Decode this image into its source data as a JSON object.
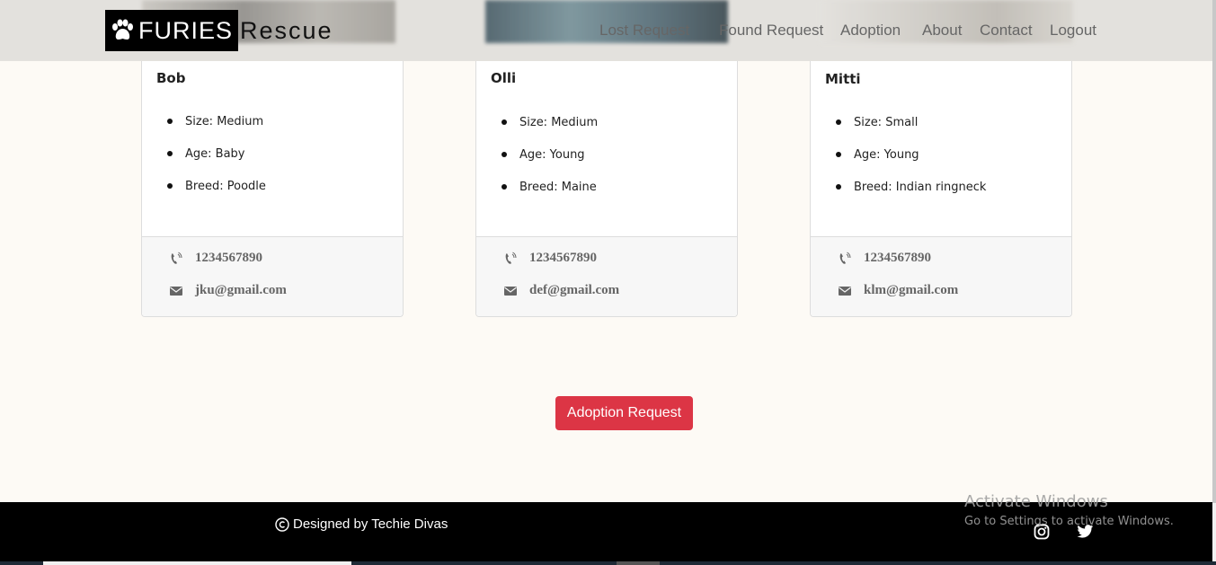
{
  "brand": {
    "highlight": "FURIES",
    "rest": "Rescue"
  },
  "nav": {
    "links": [
      "Lost Request",
      "Found Request",
      "Adoption",
      "About",
      "Contact",
      "Logout"
    ]
  },
  "pets": [
    {
      "name": "Bob",
      "details": [
        "Size: Medium",
        "Age: Baby",
        "Breed: Poodle"
      ],
      "phone": "1234567890",
      "email": "jku@gmail.com"
    },
    {
      "name": "Olli",
      "details": [
        "Size: Medium",
        "Age: Young",
        "Breed: Maine"
      ],
      "phone": "1234567890",
      "email": "def@gmail.com"
    },
    {
      "name": "Mitti",
      "details": [
        "Size: Small",
        "Age: Young",
        "Breed: Indian ringneck"
      ],
      "phone": "1234567890",
      "email": "klm@gmail.com"
    }
  ],
  "adoption_button": "Adoption Request",
  "footer": {
    "credit": "Designed by Techie Divas"
  },
  "watermark": {
    "line1": "Activate Windows",
    "line2": "Go to Settings to activate Windows."
  },
  "colors": {
    "accent": "#dc3545",
    "footer_bg": "#000000",
    "page_bg": "#fdfaf5"
  }
}
